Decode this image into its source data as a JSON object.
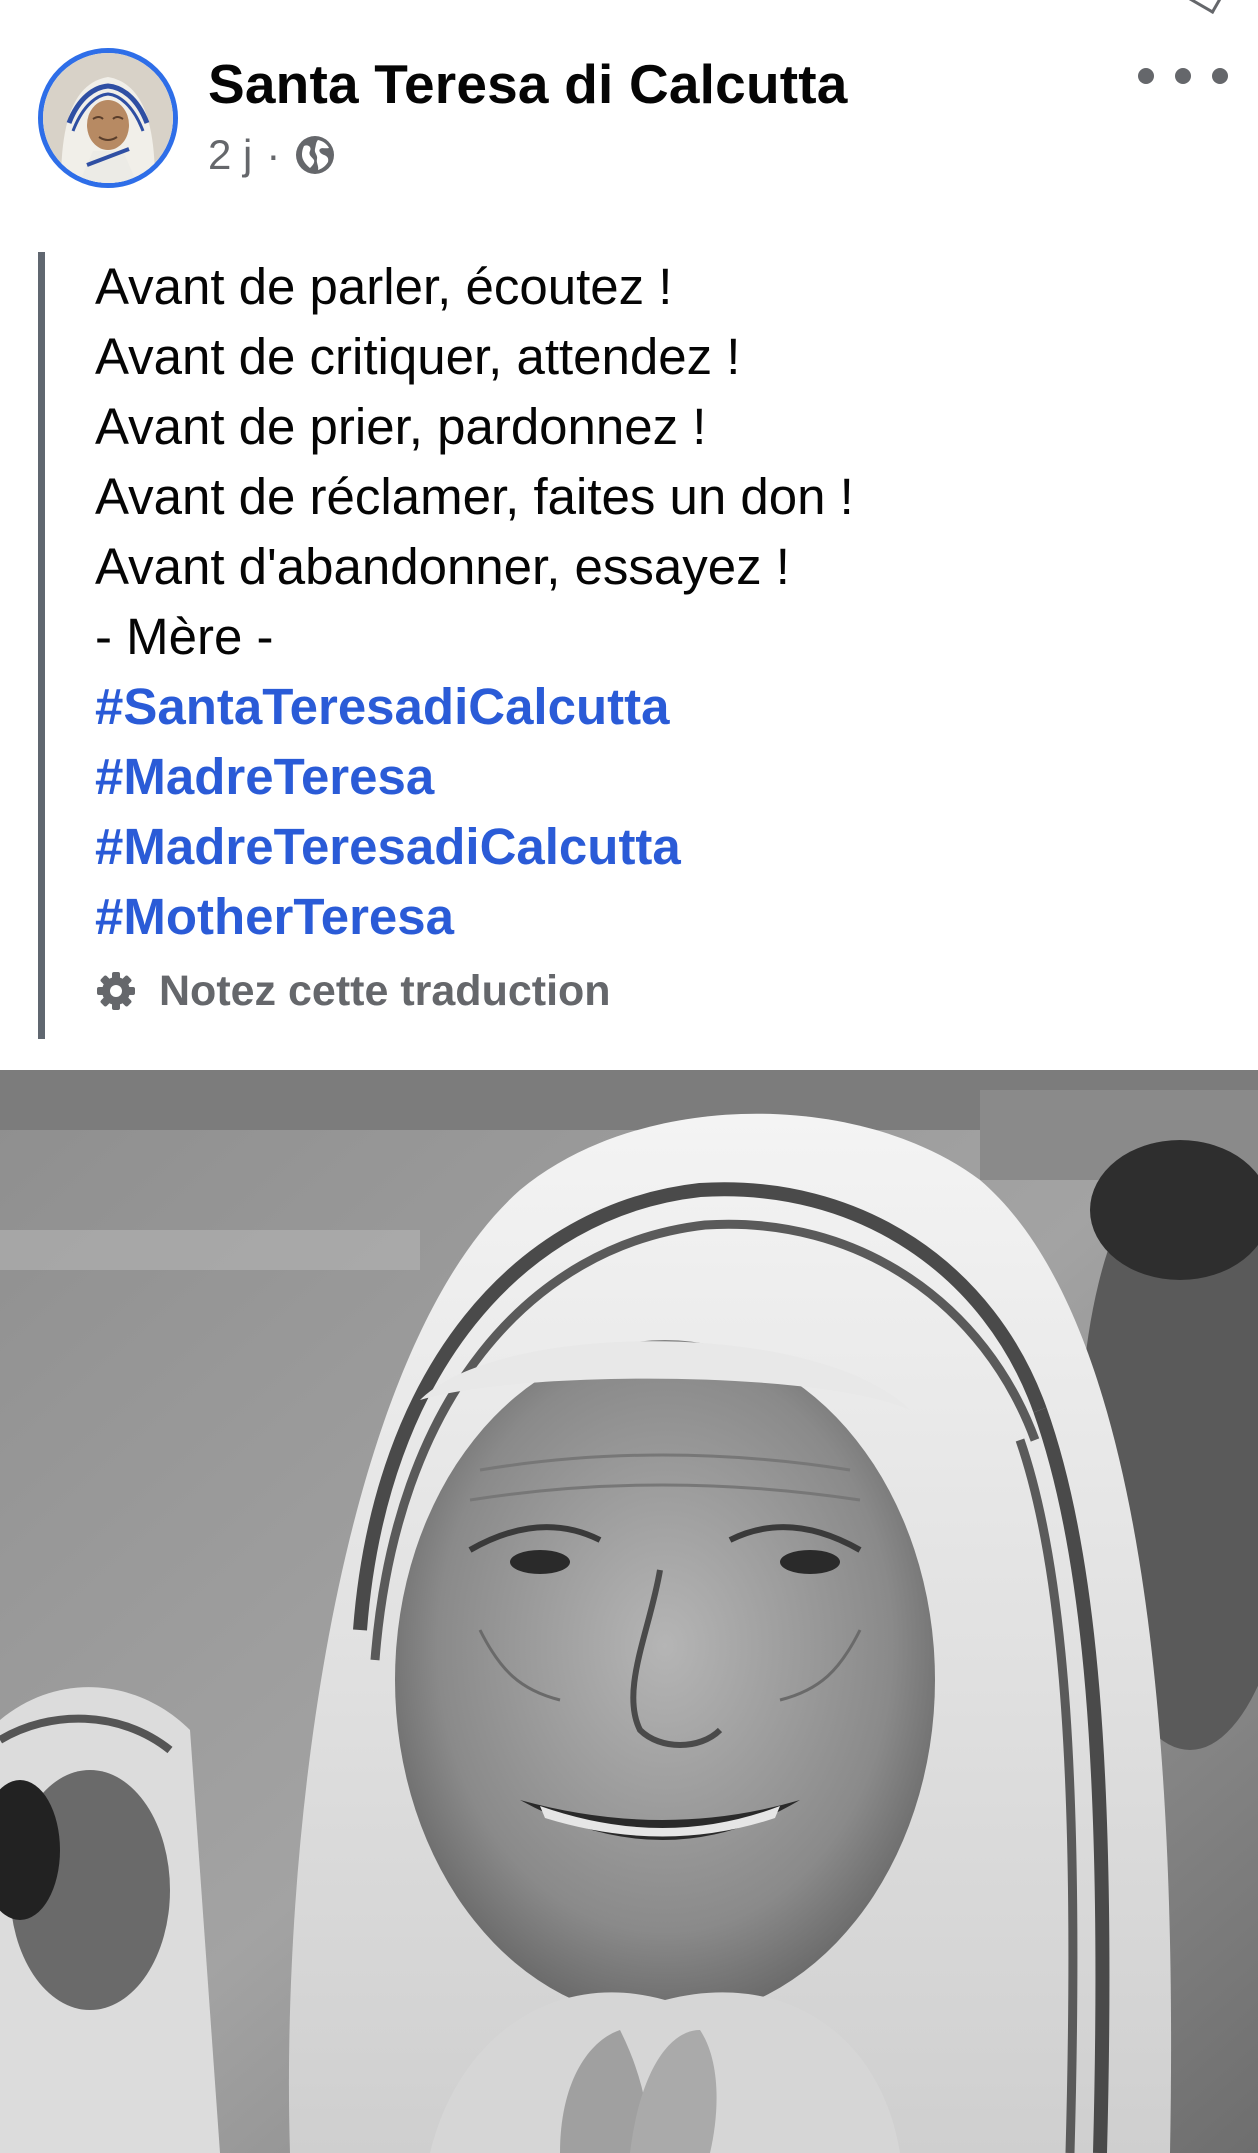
{
  "post": {
    "author": "Santa Teresa di Calcutta",
    "time": "2 j",
    "separator": "·",
    "audience_icon": "globe-icon",
    "more_icon": "more-options-icon"
  },
  "quote": {
    "lines": [
      "Avant de parler, écoutez !",
      "Avant de critiquer, attendez !",
      "Avant de prier, pardonnez !",
      "Avant de réclamer, faites un don !",
      "Avant d'abandonner, essayez !",
      "- Mère -"
    ],
    "hashtags": [
      "#SantaTeresadiCalcutta",
      "#MadreTeresa",
      "#MadreTeresadiCalcutta",
      "#MotherTeresa"
    ],
    "rate_translation": "Notez cette traduction",
    "rate_icon": "gear-icon"
  },
  "colors": {
    "avatar_ring": "#2e6ee8",
    "hashtag": "#2a5bd7",
    "secondary_text": "#65676b",
    "quote_bar": "#606770"
  }
}
